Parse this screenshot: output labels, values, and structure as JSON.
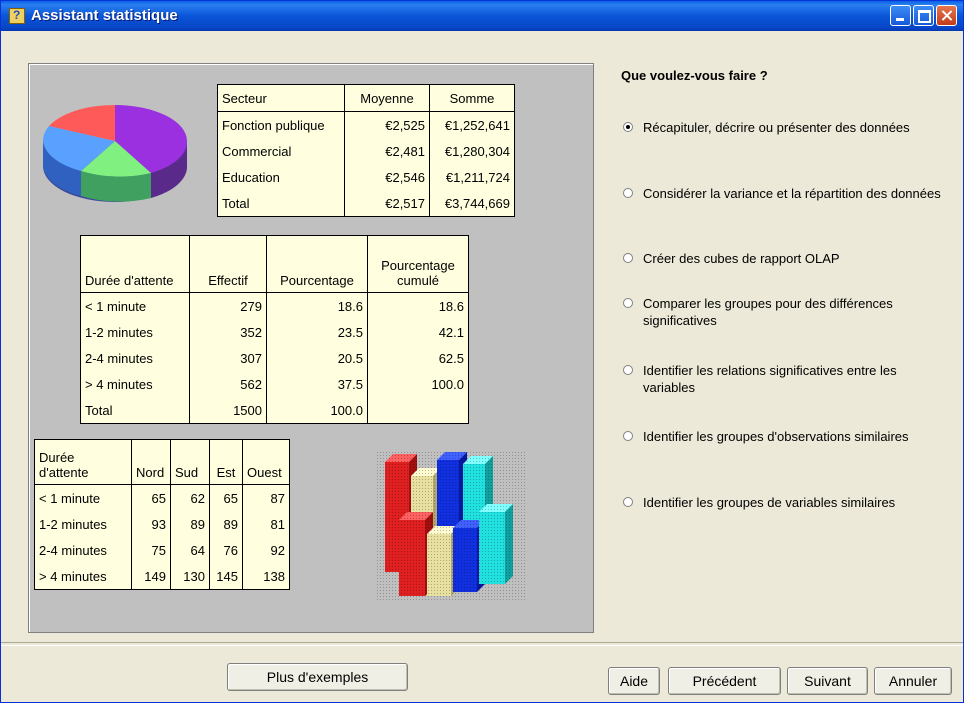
{
  "window": {
    "title": "Assistant statistique"
  },
  "preview": {
    "table1": {
      "headers": [
        "Secteur",
        "Moyenne",
        "Somme"
      ],
      "rows": [
        [
          "Fonction publique",
          "€2,525",
          "€1,252,641"
        ],
        [
          "Commercial",
          "€2,481",
          "€1,280,304"
        ],
        [
          "Education",
          "€2,546",
          "€1,211,724"
        ],
        [
          "Total",
          "€2,517",
          "€3,744,669"
        ]
      ]
    },
    "table2": {
      "headers": [
        "Durée d'attente",
        "Effectif",
        "Pourcentage",
        "Pourcentage\ncumulé"
      ],
      "rows": [
        [
          "< 1 minute",
          "279",
          "18.6",
          "18.6"
        ],
        [
          "1-2 minutes",
          "352",
          "23.5",
          "42.1"
        ],
        [
          "2-4 minutes",
          "307",
          "20.5",
          "62.5"
        ],
        [
          "> 4 minutes",
          "562",
          "37.5",
          "100.0"
        ],
        [
          "Total",
          "1500",
          "100.0",
          ""
        ]
      ]
    },
    "table3": {
      "headers": [
        "Durée\nd'attente",
        "Nord",
        "Sud",
        "Est",
        "Ouest"
      ],
      "rows": [
        [
          "< 1 minute",
          "65",
          "62",
          "65",
          "87"
        ],
        [
          "1-2 minutes",
          "93",
          "89",
          "89",
          "81"
        ],
        [
          "2-4 minutes",
          "75",
          "64",
          "76",
          "92"
        ],
        [
          "> 4 minutes",
          "149",
          "130",
          "145",
          "138"
        ]
      ]
    }
  },
  "wizard": {
    "question": "Que voulez-vous faire ?",
    "options": [
      {
        "label": "Récapituler, décrire ou présenter des données",
        "selected": true
      },
      {
        "label": "Considérer la variance et la répartition des données",
        "selected": false
      },
      {
        "label": "Créer des cubes de rapport OLAP",
        "selected": false
      },
      {
        "label": "Comparer les groupes pour des différences significatives",
        "selected": false
      },
      {
        "label": "Identifier les relations significatives entre les variables",
        "selected": false
      },
      {
        "label": "Identifier les groupes d'observations similaires",
        "selected": false
      },
      {
        "label": "Identifier les groupes de variables similaires",
        "selected": false
      }
    ]
  },
  "buttons": {
    "more_examples": "Plus d'exemples",
    "help": "Aide",
    "previous": "Précédent",
    "next": "Suivant",
    "cancel": "Annuler"
  }
}
